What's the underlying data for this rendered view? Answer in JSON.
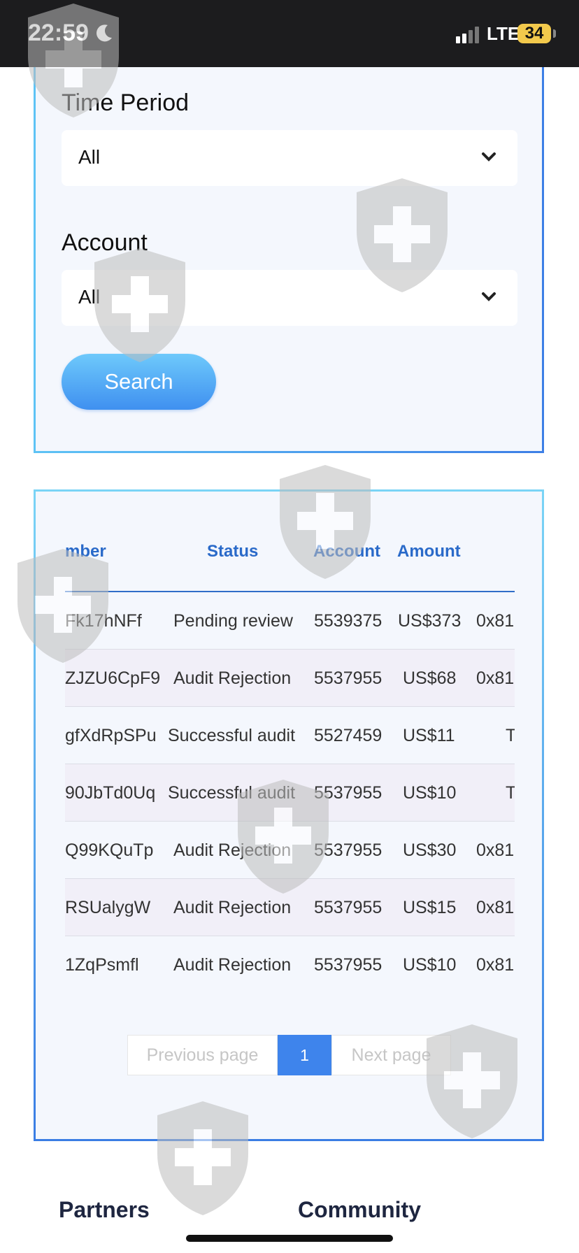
{
  "status_bar": {
    "time": "22:59",
    "network": "LTE",
    "battery": "34"
  },
  "filters": {
    "time_period": {
      "label": "Time Period",
      "value": "All"
    },
    "account": {
      "label": "Account",
      "value": "All"
    },
    "search_label": "Search"
  },
  "table": {
    "columns": [
      "mber",
      "Status",
      "Account",
      "Amount"
    ],
    "rows": [
      {
        "number": "Fk17hNFf",
        "status": "Pending review",
        "account": "5539375",
        "amount": "US$373",
        "extra": "0x81"
      },
      {
        "number": "ZJZU6CpF9",
        "status": "Audit Rejection",
        "account": "5537955",
        "amount": "US$68",
        "extra": "0x81"
      },
      {
        "number": "gfXdRpSPu",
        "status": "Successful audit",
        "account": "5527459",
        "amount": "US$11",
        "extra": "T"
      },
      {
        "number": "90JbTd0Uq",
        "status": "Successful audit",
        "account": "5537955",
        "amount": "US$10",
        "extra": "T"
      },
      {
        "number": "Q99KQuTp",
        "status": "Audit Rejection",
        "account": "5537955",
        "amount": "US$30",
        "extra": "0x81"
      },
      {
        "number": "RSUalygW",
        "status": "Audit Rejection",
        "account": "5537955",
        "amount": "US$15",
        "extra": "0x81"
      },
      {
        "number": "1ZqPsmfl",
        "status": "Audit Rejection",
        "account": "5537955",
        "amount": "US$10",
        "extra": "0x81"
      }
    ]
  },
  "pagination": {
    "previous": "Previous page",
    "current": "1",
    "next": "Next page"
  },
  "footer": {
    "partners": "Partners",
    "community": "Community"
  },
  "colors": {
    "accent": "#3e84ec",
    "header_text": "#2a6ac9",
    "card_bg": "#f4f7fd"
  }
}
